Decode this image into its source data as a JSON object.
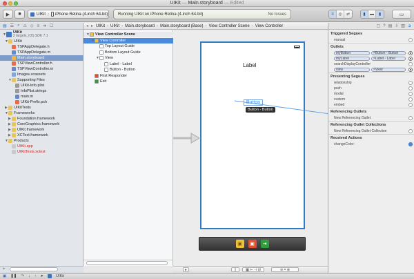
{
  "window": {
    "title_project": "UIKit",
    "title_file": "Main.storyboard",
    "title_status": "Edited"
  },
  "toolbar": {
    "run_icon": "▶",
    "stop_icon": "■",
    "scheme_target": "UIKit",
    "scheme_device": "iPhone Retina (4-inch 64-bit)",
    "activity_text": "Running UIKit on iPhone Retina (4-inch 64-bit)",
    "issues_text": "No Issues"
  },
  "navigator": {
    "project_name": "UIKit",
    "project_sub": "2 targets, iOS SDK 7.1",
    "items": [
      {
        "label": "UIKit",
        "indent": 1,
        "disc": "▼",
        "kind": "folder"
      },
      {
        "label": "TSPAppDelegate.h",
        "indent": 2,
        "disc": "",
        "kind": "h"
      },
      {
        "label": "TSPAppDelegate.m",
        "indent": 2,
        "disc": "",
        "kind": "m"
      },
      {
        "label": "Main.storyboard",
        "indent": 2,
        "disc": "",
        "kind": "sb",
        "selected": true
      },
      {
        "label": "TSPViewController.h",
        "indent": 2,
        "disc": "",
        "kind": "h"
      },
      {
        "label": "TSPViewController.m",
        "indent": 2,
        "disc": "",
        "kind": "m"
      },
      {
        "label": "Images.xcassets",
        "indent": 2,
        "disc": "",
        "kind": "assets"
      },
      {
        "label": "Supporting Files",
        "indent": 2,
        "disc": "▼",
        "kind": "folder"
      },
      {
        "label": "UIKit-Info.plist",
        "indent": 3,
        "disc": "",
        "kind": "plist"
      },
      {
        "label": "InfoPlist.strings",
        "indent": 3,
        "disc": "",
        "kind": "plist"
      },
      {
        "label": "main.m",
        "indent": 3,
        "disc": "",
        "kind": "m"
      },
      {
        "label": "UIKit-Prefix.pch",
        "indent": 3,
        "disc": "",
        "kind": "h"
      },
      {
        "label": "UIKitTests",
        "indent": 1,
        "disc": "▶",
        "kind": "folder"
      },
      {
        "label": "Frameworks",
        "indent": 1,
        "disc": "▼",
        "kind": "folder"
      },
      {
        "label": "Foundation.framework",
        "indent": 2,
        "disc": "▶",
        "kind": "fw"
      },
      {
        "label": "CoreGraphics.framework",
        "indent": 2,
        "disc": "▶",
        "kind": "fw"
      },
      {
        "label": "UIKit.framework",
        "indent": 2,
        "disc": "▶",
        "kind": "fw"
      },
      {
        "label": "XCTest.framework",
        "indent": 2,
        "disc": "▶",
        "kind": "fw"
      },
      {
        "label": "Products",
        "indent": 1,
        "disc": "▼",
        "kind": "folder"
      },
      {
        "label": "UIKit.app",
        "indent": 2,
        "disc": "",
        "kind": "app",
        "red": true
      },
      {
        "label": "UIKitTests.xctest",
        "indent": 2,
        "disc": "",
        "kind": "app",
        "red": true
      }
    ]
  },
  "jumpbar": {
    "items": [
      "UIKit",
      "UIKit",
      "Main.storyboard",
      "Main.storyboard (Base)",
      "View Controller Scene",
      "View Controller"
    ]
  },
  "outline": {
    "items": [
      {
        "label": "View Controller Scene",
        "indent": 0,
        "disc": "▼",
        "kind": "scene",
        "header": true
      },
      {
        "label": "View Controller",
        "indent": 1,
        "disc": "▼",
        "kind": "vc",
        "selected": true
      },
      {
        "label": "Top Layout Guide",
        "indent": 2,
        "disc": "",
        "kind": "guide"
      },
      {
        "label": "Bottom Layout Guide",
        "indent": 2,
        "disc": "",
        "kind": "guide"
      },
      {
        "label": "View",
        "indent": 2,
        "disc": "▼",
        "kind": "view"
      },
      {
        "label": "Label - Label",
        "indent": 3,
        "disc": "",
        "kind": "label"
      },
      {
        "label": "Button - Button",
        "indent": 3,
        "disc": "",
        "kind": "label"
      },
      {
        "label": "First Responder",
        "indent": 1,
        "disc": "",
        "kind": "responder"
      },
      {
        "label": "Exit",
        "indent": 1,
        "disc": "",
        "kind": "exit"
      }
    ]
  },
  "canvas": {
    "label_text": "Label",
    "button_text": "Button",
    "tooltip_text": "Button - Button"
  },
  "inspector": {
    "triggered_segues": {
      "title": "Triggered Segues",
      "items": [
        "manual"
      ]
    },
    "outlets": {
      "title": "Outlets",
      "items": [
        {
          "name": "myButton",
          "target": "Button - Button",
          "connected": true
        },
        {
          "name": "myLabel",
          "target": "Label - Label",
          "connected": true
        },
        {
          "name": "searchDisplayController",
          "target": "",
          "connected": false
        },
        {
          "name": "view",
          "target": "View",
          "connected": true
        }
      ]
    },
    "presenting_segues": {
      "title": "Presenting Segues",
      "items": [
        "relationship",
        "push",
        "modal",
        "custom",
        "embed"
      ]
    },
    "referencing_outlets": {
      "title": "Referencing Outlets",
      "items": [
        "New Referencing Outlet"
      ]
    },
    "referencing_collections": {
      "title": "Referencing Outlet Collections",
      "items": [
        "New Referencing Outlet Collection"
      ]
    },
    "received_actions": {
      "title": "Received Actions",
      "items": [
        "changeColor:"
      ]
    }
  },
  "debugbar": {
    "target": "UIKit"
  },
  "colors": {
    "accent": "#2f7bc4",
    "selection": "#4a89dc",
    "connection_line": "#5ba0e6"
  }
}
